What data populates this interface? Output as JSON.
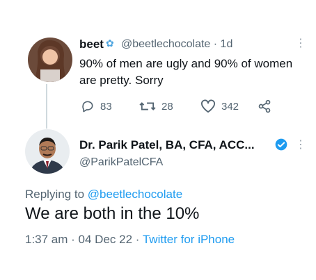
{
  "original_tweet": {
    "display_name": "beet",
    "handle": "@beetlechocolate",
    "time": "· 1d",
    "more_icon": "⋮",
    "text": "90% of men are ugly and 90% of women are pretty. Sorry",
    "replies": "83",
    "retweets": "28",
    "likes": "342"
  },
  "reply_tweet": {
    "display_name": "Dr. Parik Patel, BA, CFA, ACC...",
    "handle": "@ParikPatelCFA",
    "more_icon": "⋮",
    "replying_prefix": "Replying to",
    "replying_to": "@beetlechocolate",
    "text": "We are both in the 10%",
    "timestamp": "1:37 am · 04 Dec 22 · ",
    "source": "Twitter for iPhone"
  },
  "colors": {
    "accent": "#1d9bf0",
    "secondary_text": "#536471",
    "thread_line": "#cfd9de"
  }
}
